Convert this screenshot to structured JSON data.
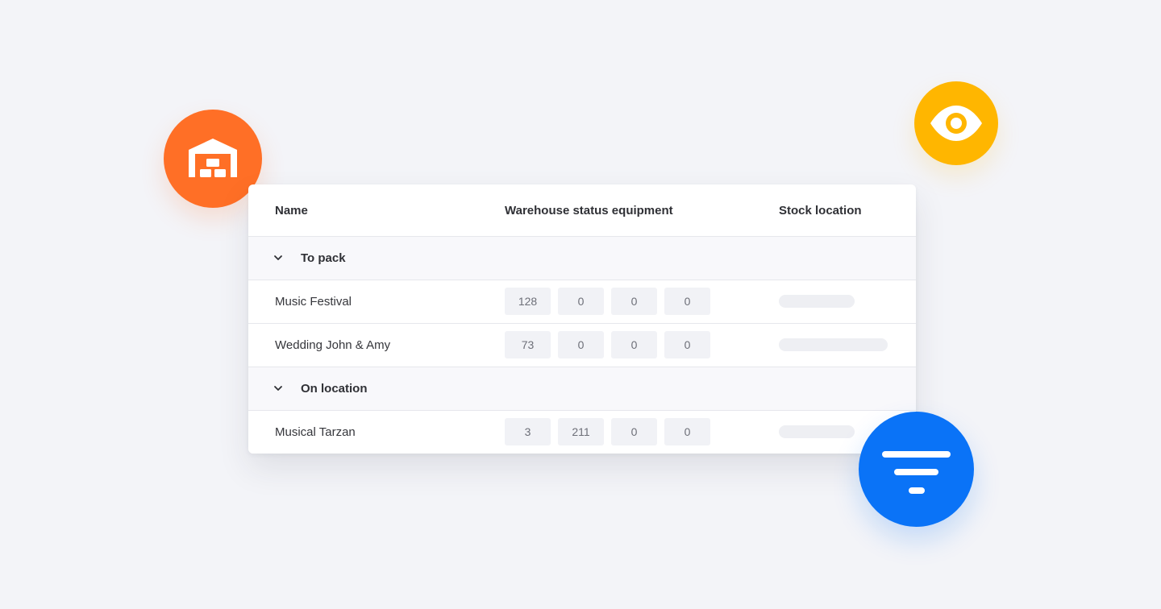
{
  "table": {
    "headers": {
      "name": "Name",
      "status": "Warehouse status equipment",
      "stock": "Stock location"
    },
    "groups": [
      {
        "label": "To pack",
        "rows": [
          {
            "name": "Music Festival",
            "values": [
              "128",
              "0",
              "0",
              "0"
            ],
            "stock_fill": 0.65
          },
          {
            "name": "Wedding John & Amy",
            "values": [
              "73",
              "0",
              "0",
              "0"
            ],
            "stock_fill": 0.94
          }
        ]
      },
      {
        "label": "On location",
        "rows": [
          {
            "name": "Musical Tarzan",
            "values": [
              "3",
              "211",
              "0",
              "0"
            ],
            "stock_fill": 0.65
          }
        ]
      }
    ]
  },
  "icons": {
    "warehouse": "warehouse-icon",
    "eye": "eye-icon",
    "filter": "filter-icon",
    "chevron": "chevron-down-icon"
  },
  "colors": {
    "warehouse_accent": "#ff6f26",
    "eye_accent": "#ffb600",
    "filter_accent": "#0a73f7"
  }
}
